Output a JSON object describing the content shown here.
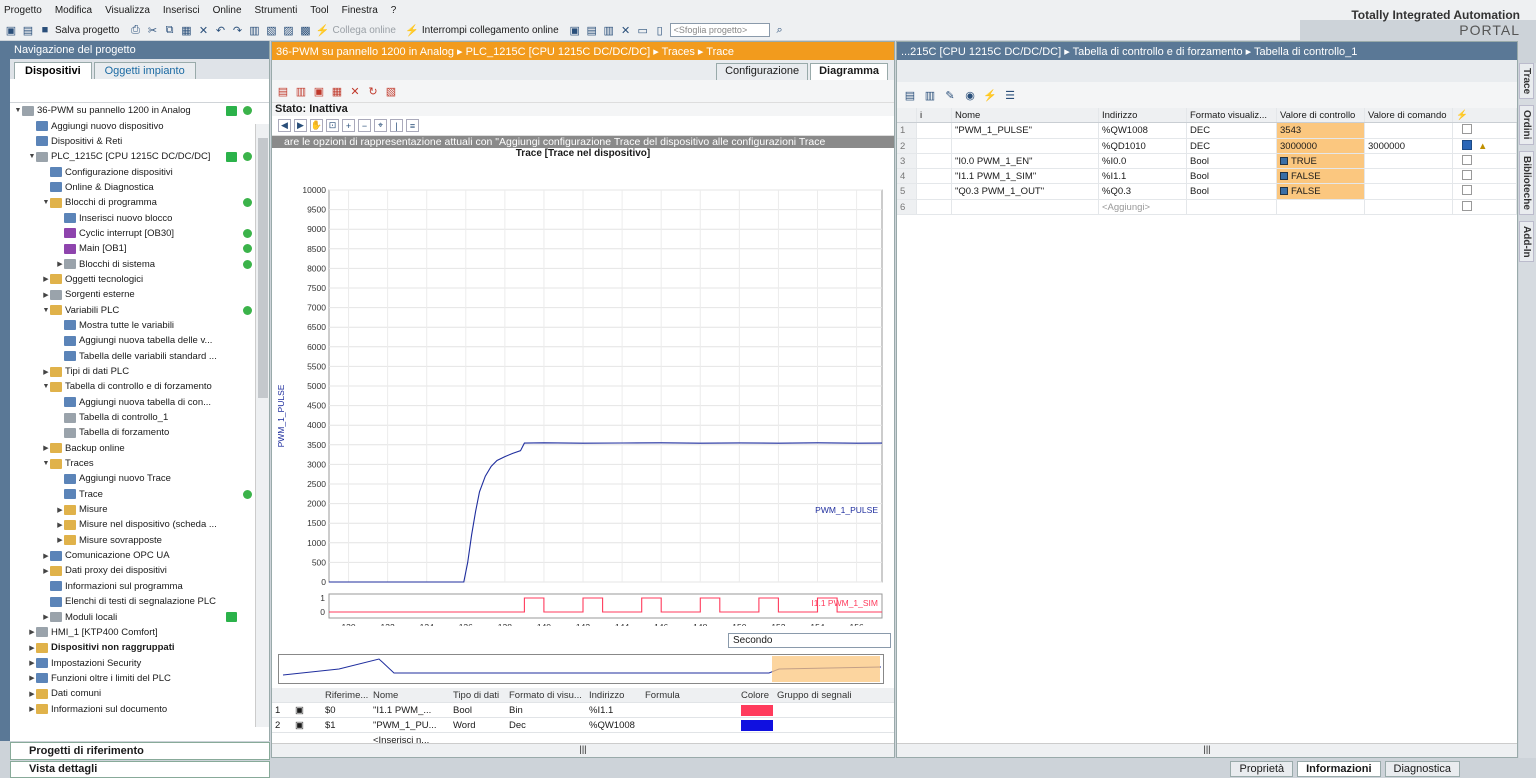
{
  "menu": [
    "Progetto",
    "Modifica",
    "Visualizza",
    "Inserisci",
    "Online",
    "Strumenti",
    "Tool",
    "Finestra",
    "?"
  ],
  "toolbar": {
    "save_label": "Salva progetto",
    "connect_label": "Collega online",
    "disconnect_label": "Interrompi collegamento online",
    "search_placeholder": "<Sfoglia progetto>"
  },
  "brand": {
    "line1": "Totally Integrated Automation",
    "line2": "PORTAL"
  },
  "nav": {
    "title": "Navigazione del progetto",
    "tabs": [
      "Dispositivi",
      "Oggetti impianto"
    ],
    "tree": [
      {
        "label": "36-PWM su pannello 1200 in Analog",
        "indent": 0,
        "tw": "▼",
        "ic": "grey",
        "check": true,
        "dot": true
      },
      {
        "label": "Aggiungi nuovo dispositivo",
        "indent": 1,
        "tw": "",
        "ic": "blue"
      },
      {
        "label": "Dispositivi & Reti",
        "indent": 1,
        "tw": "",
        "ic": "blue"
      },
      {
        "label": "PLC_1215C [CPU 1215C DC/DC/DC]",
        "indent": 1,
        "tw": "▼",
        "ic": "grey",
        "check": true,
        "dot": true
      },
      {
        "label": "Configurazione dispositivi",
        "indent": 2,
        "tw": "",
        "ic": "blue"
      },
      {
        "label": "Online & Diagnostica",
        "indent": 2,
        "tw": "",
        "ic": "blue"
      },
      {
        "label": "Blocchi di programma",
        "indent": 2,
        "tw": "▼",
        "ic": "yel",
        "dot": true
      },
      {
        "label": "Inserisci nuovo blocco",
        "indent": 3,
        "tw": "",
        "ic": "blue"
      },
      {
        "label": "Cyclic interrupt [OB30]",
        "indent": 3,
        "tw": "",
        "ic": "pur",
        "dot": true
      },
      {
        "label": "Main [OB1]",
        "indent": 3,
        "tw": "",
        "ic": "pur",
        "dot": true
      },
      {
        "label": "Blocchi di sistema",
        "indent": 3,
        "tw": "▶",
        "ic": "grey",
        "dot": true
      },
      {
        "label": "Oggetti tecnologici",
        "indent": 2,
        "tw": "▶",
        "ic": "yel"
      },
      {
        "label": "Sorgenti esterne",
        "indent": 2,
        "tw": "▶",
        "ic": "grey"
      },
      {
        "label": "Variabili PLC",
        "indent": 2,
        "tw": "▼",
        "ic": "yel",
        "dot": true
      },
      {
        "label": "Mostra tutte le variabili",
        "indent": 3,
        "tw": "",
        "ic": "blue"
      },
      {
        "label": "Aggiungi nuova tabella delle v...",
        "indent": 3,
        "tw": "",
        "ic": "blue"
      },
      {
        "label": "Tabella delle variabili standard ...",
        "indent": 3,
        "tw": "",
        "ic": "blue"
      },
      {
        "label": "Tipi di dati PLC",
        "indent": 2,
        "tw": "▶",
        "ic": "yel"
      },
      {
        "label": "Tabella di controllo e di forzamento",
        "indent": 2,
        "tw": "▼",
        "ic": "yel"
      },
      {
        "label": "Aggiungi nuova tabella di con...",
        "indent": 3,
        "tw": "",
        "ic": "blue"
      },
      {
        "label": "Tabella di controllo_1",
        "indent": 3,
        "tw": "",
        "ic": "grey"
      },
      {
        "label": "Tabella di forzamento",
        "indent": 3,
        "tw": "",
        "ic": "grey"
      },
      {
        "label": "Backup online",
        "indent": 2,
        "tw": "▶",
        "ic": "yel"
      },
      {
        "label": "Traces",
        "indent": 2,
        "tw": "▼",
        "ic": "yel"
      },
      {
        "label": "Aggiungi nuovo Trace",
        "indent": 3,
        "tw": "",
        "ic": "blue"
      },
      {
        "label": "Trace",
        "indent": 3,
        "tw": "",
        "ic": "blue",
        "dot": true
      },
      {
        "label": "Misure",
        "indent": 3,
        "tw": "▶",
        "ic": "yel"
      },
      {
        "label": "Misure nel dispositivo (scheda ...",
        "indent": 3,
        "tw": "▶",
        "ic": "yel"
      },
      {
        "label": "Misure sovrapposte",
        "indent": 3,
        "tw": "▶",
        "ic": "yel"
      },
      {
        "label": "Comunicazione OPC UA",
        "indent": 2,
        "tw": "▶",
        "ic": "blue"
      },
      {
        "label": "Dati proxy dei dispositivi",
        "indent": 2,
        "tw": "▶",
        "ic": "yel"
      },
      {
        "label": "Informazioni sul programma",
        "indent": 2,
        "tw": "",
        "ic": "blue"
      },
      {
        "label": "Elenchi di testi di segnalazione PLC",
        "indent": 2,
        "tw": "",
        "ic": "blue"
      },
      {
        "label": "Moduli locali",
        "indent": 2,
        "tw": "▶",
        "ic": "grey",
        "check": true
      },
      {
        "label": "HMI_1 [KTP400 Comfort]",
        "indent": 1,
        "tw": "▶",
        "ic": "grey"
      },
      {
        "label": "Dispositivi non raggruppati",
        "indent": 1,
        "tw": "▶",
        "ic": "yel"
      },
      {
        "label": "Impostazioni Security",
        "indent": 1,
        "tw": "▶",
        "ic": "blue"
      },
      {
        "label": "Funzioni oltre i limiti del PLC",
        "indent": 1,
        "tw": "▶",
        "ic": "blue"
      },
      {
        "label": "Dati comuni",
        "indent": 1,
        "tw": "▶",
        "ic": "yel"
      },
      {
        "label": "Informazioni sul documento",
        "indent": 1,
        "tw": "▶",
        "ic": "yel"
      }
    ],
    "ref_projects": "Progetti di riferimento",
    "details": "Vista dettagli"
  },
  "trace": {
    "title": "36-PWM su pannello 1200 in Analog ▸ PLC_1215C [CPU 1215C DC/DC/DC] ▸ Traces ▸ Trace",
    "tabs": [
      "Configurazione",
      "Diagramma"
    ],
    "status": "Stato: Inattiva",
    "banner": "are le opzioni di rappresentazione attuali con \"Aggiungi configurazione Trace del dispositivo alle configurazioni Trace",
    "chart_title": "Trace [Trace nel dispositivo]",
    "time_unit": "Secondo",
    "signal_headers": [
      "Riferime...",
      "Nome",
      "Tipo di dati",
      "Formato di visu...",
      "Indirizzo",
      "Formula",
      "Colore",
      "Gruppo di segnali"
    ],
    "signals": [
      {
        "num": "1",
        "ref": "$0",
        "name": "\"I1.1 PWM_...",
        "type": "Bool",
        "format": "Bin",
        "addr": "%I1.1",
        "color": "#ff3b5c"
      },
      {
        "num": "2",
        "ref": "$1",
        "name": "\"PWM_1_PU...",
        "type": "Word",
        "format": "Dec",
        "addr": "%QW1008",
        "color": "#1010e0"
      }
    ],
    "insert_label": "<Inserisci n..."
  },
  "chart_data": {
    "type": "line",
    "title": "Trace [Trace nel dispositivo]",
    "xlabel": "[s]",
    "ylabel": "PWM_1_PULSE",
    "xlim": [
      129,
      157.3
    ],
    "ylim": [
      0,
      10000
    ],
    "x_ticks": [
      130,
      132,
      134,
      136,
      138,
      140,
      142,
      144,
      146,
      148,
      150,
      152,
      154,
      156
    ],
    "y_ticks": [
      0,
      500,
      1000,
      1500,
      2000,
      2500,
      3000,
      3500,
      4000,
      4500,
      5000,
      5500,
      6000,
      6500,
      7000,
      7500,
      8000,
      8500,
      9000,
      9500,
      10000
    ],
    "series": [
      {
        "name": "PWM_1_PULSE",
        "color": "#1f2e9e",
        "x": [
          129,
          135.9,
          136.1,
          136.3,
          136.5,
          136.7,
          137.0,
          137.3,
          137.6,
          138.0,
          138.4,
          138.8,
          139.0,
          140,
          142,
          144,
          146,
          148,
          150,
          152,
          154,
          156,
          157.3
        ],
        "y": [
          0,
          0,
          500,
          1200,
          1800,
          2300,
          2700,
          2950,
          3100,
          3200,
          3280,
          3350,
          3543,
          3550,
          3540,
          3545,
          3550,
          3540,
          3548,
          3542,
          3550,
          3540,
          3543
        ]
      },
      {
        "name": "I1.1 PWM_1_SIM",
        "color": "#ff3b5c",
        "pulses": [
          [
            139.0,
            140.0
          ],
          [
            142.0,
            143.0
          ],
          [
            145.0,
            146.0
          ],
          [
            148.0,
            149.0
          ],
          [
            151.0,
            152.0
          ],
          [
            154.0,
            155.0
          ]
        ]
      }
    ],
    "bool_ticks": [
      "1",
      "0"
    ]
  },
  "tbl": {
    "title": "...215C [CPU 1215C DC/DC/DC] ▸ Tabella di controllo e di forzamento ▸ Tabella di controllo_1",
    "headers": [
      "i",
      "Nome",
      "Indirizzo",
      "Formato visualiz...",
      "Valore di controllo",
      "Valore di comando",
      "⚡"
    ],
    "rows": [
      {
        "num": "1",
        "name": "\"PWM_1_PULSE\"",
        "addr": "%QW1008",
        "fmt": "DEC",
        "val": "3543",
        "cmd": "",
        "bool": false,
        "checked": false,
        "warn": false
      },
      {
        "num": "2",
        "name": "",
        "addr": "%QD1010",
        "fmt": "DEC",
        "val": "3000000",
        "cmd": "3000000",
        "bool": false,
        "checked": true,
        "warn": true
      },
      {
        "num": "3",
        "name": "\"I0.0 PWM_1_EN\"",
        "addr": "%I0.0",
        "fmt": "Bool",
        "val": "TRUE",
        "cmd": "",
        "bool": true,
        "checked": false,
        "warn": false
      },
      {
        "num": "4",
        "name": "\"I1.1 PWM_1_SIM\"",
        "addr": "%I1.1",
        "fmt": "Bool",
        "val": "FALSE",
        "cmd": "",
        "bool": true,
        "checked": false,
        "warn": false
      },
      {
        "num": "5",
        "name": "\"Q0.3 PWM_1_OUT\"",
        "addr": "%Q0.3",
        "fmt": "Bool",
        "val": "FALSE",
        "cmd": "",
        "bool": true,
        "checked": false,
        "warn": false
      },
      {
        "num": "6",
        "name": "",
        "addr": "<Aggiungi>",
        "fmt": "",
        "val": "",
        "cmd": "",
        "bool": false,
        "checked": false,
        "warn": false
      }
    ]
  },
  "side_tabs": [
    "Trace",
    "Ordini",
    "Biblioteche",
    "Add-In"
  ],
  "status_tabs": [
    "Proprietà",
    "Informazioni",
    "Diagnostica"
  ]
}
